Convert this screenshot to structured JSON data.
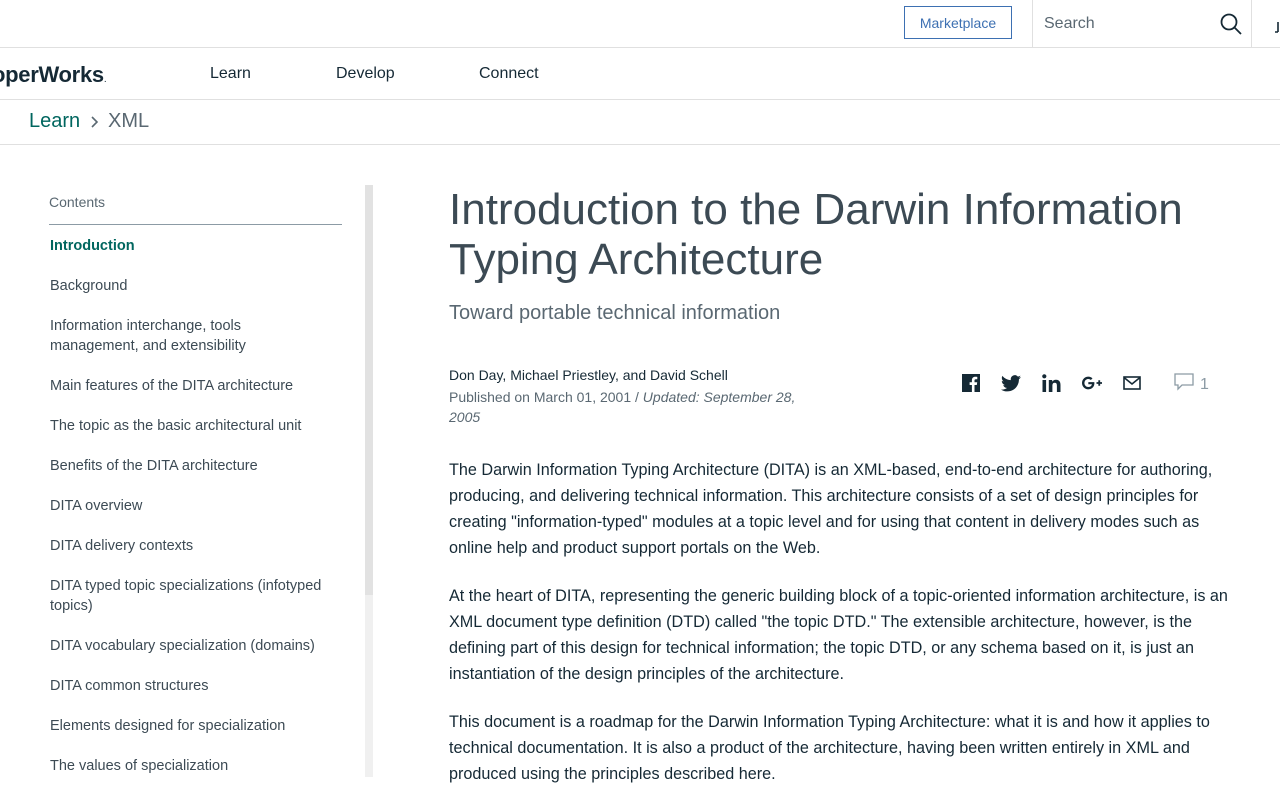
{
  "topbar": {
    "marketplace_label": "Marketplace",
    "search_placeholder": "Search"
  },
  "nav": {
    "logo_text": "operWorks",
    "logo_mark": ".",
    "links": [
      "Learn",
      "Develop",
      "Connect"
    ]
  },
  "breadcrumb": {
    "parent": "Learn",
    "current": "XML"
  },
  "toc": {
    "title": "Contents",
    "items": [
      "Introduction",
      "Background",
      "Information interchange, tools management, and extensibility",
      "Main features of the DITA architecture",
      "The topic as the basic architectural unit",
      "Benefits of the DITA architecture",
      "DITA overview",
      "DITA delivery contexts",
      "DITA typed topic specializations (infotyped topics)",
      "DITA vocabulary specialization (domains)",
      "DITA common structures",
      "Elements designed for specialization",
      "The values of specialization"
    ]
  },
  "article": {
    "title": "Introduction to the Darwin Information Typing Architecture",
    "subtitle": "Toward portable technical information",
    "authors": "Don Day, Michael Priestley, and David Schell",
    "published": "Published on March 01, 2001",
    "separator": "/",
    "updated": "Updated: September 28, 2005",
    "comment_count": "1",
    "paragraphs": [
      "The Darwin Information Typing Architecture (DITA) is an XML-based, end-to-end architecture for authoring, producing, and delivering technical information. This architecture consists of a set of design principles for creating \"information-typed\" modules at a topic level and for using that content in delivery modes such as online help and product support portals on the Web.",
      "At the heart of DITA, representing the generic building block of a topic-oriented information architecture, is an XML document type definition (DTD) called \"the topic DTD.\" The extensible architecture, however, is the defining part of this design for technical information; the topic DTD, or any schema based on it, is just an instantiation of the design principles of the architecture.",
      "This document is a roadmap for the Darwin Information Typing Architecture: what it is and how it applies to technical documentation. It is also a product of the architecture, having been written entirely in XML and produced using the principles described here."
    ]
  },
  "share_icons": [
    "facebook-icon",
    "twitter-icon",
    "linkedin-icon",
    "google-plus-icon",
    "email-icon"
  ],
  "colors": {
    "accent_teal": "#00665f",
    "link_blue": "#3d70b2",
    "text_dark": "#152935",
    "text_muted": "#5a6872"
  }
}
